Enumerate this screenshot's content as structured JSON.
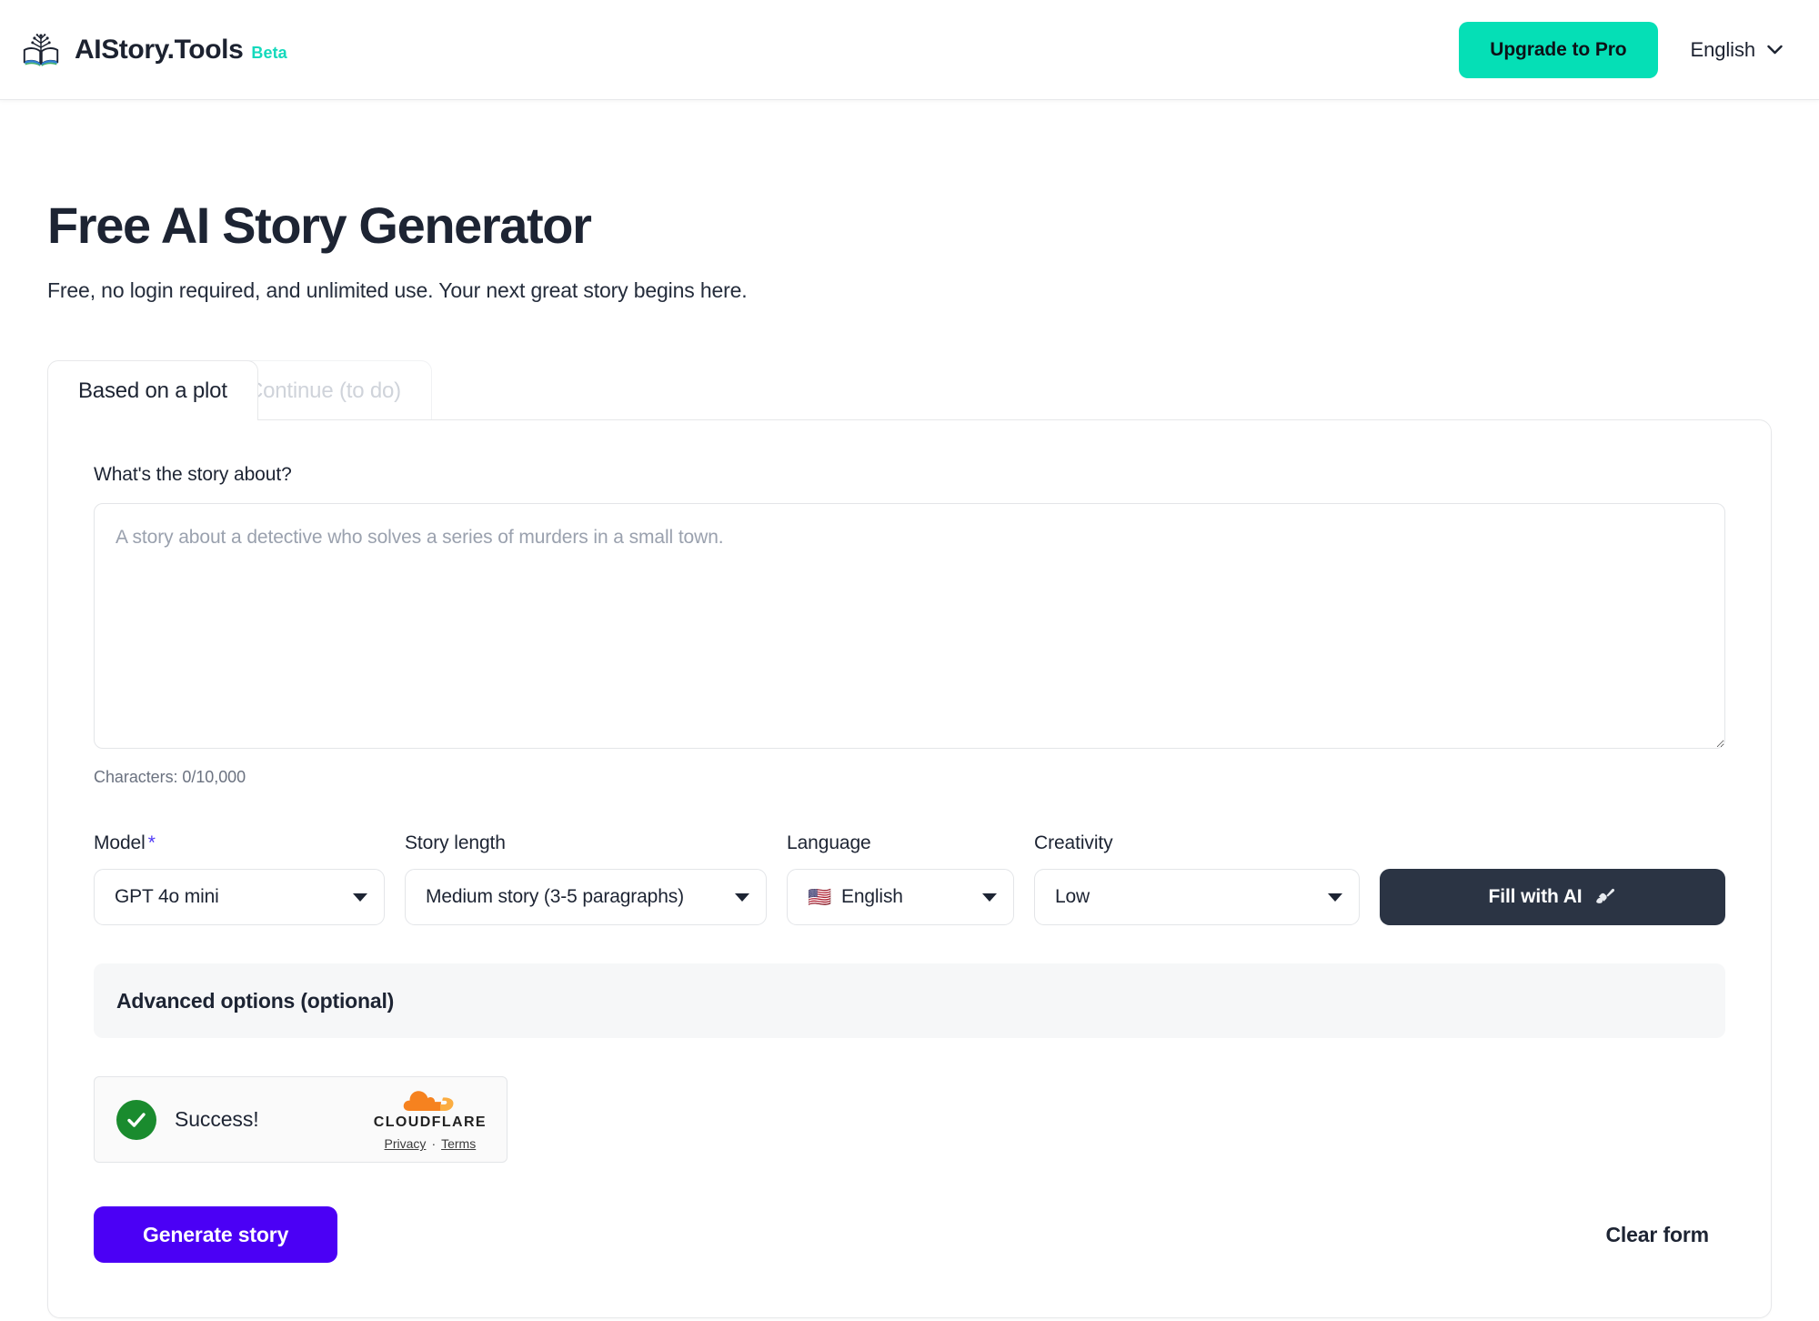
{
  "header": {
    "brand_name": "AIStory.Tools",
    "brand_badge": "Beta",
    "upgrade_label": "Upgrade to Pro",
    "language_label": "English",
    "accent_color": "#05dfb6"
  },
  "hero": {
    "title": "Free AI Story Generator",
    "subtitle": "Free, no login required, and unlimited use. Your next great story begins here."
  },
  "tabs": [
    {
      "label": "Based on a plot",
      "active": true
    },
    {
      "label": "Continue (to do)",
      "active": false
    }
  ],
  "form": {
    "story_label": "What's the story about?",
    "story_value": "",
    "story_placeholder": "A story about a detective who solves a series of murders in a small town.",
    "char_count": "Characters: 0/10,000",
    "controls": [
      {
        "label": "Model",
        "required": true,
        "value": "GPT 4o mini"
      },
      {
        "label": "Story length",
        "required": false,
        "value": "Medium story (3-5 paragraphs)"
      },
      {
        "label": "Language",
        "required": false,
        "value": "English",
        "flag": "🇺🇸"
      },
      {
        "label": "Creativity",
        "required": false,
        "value": "Low"
      }
    ],
    "fill_ai_label": "Fill with AI",
    "advanced_label": "Advanced options (optional)",
    "required_marker": "*",
    "required_color": "#4f39f6"
  },
  "turnstile": {
    "status": "Success!",
    "brand": "CLOUDFLARE",
    "privacy_label": "Privacy",
    "separator": "·",
    "terms_label": "Terms",
    "success_color": "#1a8b2e"
  },
  "actions": {
    "generate_label": "Generate story",
    "generate_color": "#4b00f5",
    "clear_label": "Clear form"
  }
}
